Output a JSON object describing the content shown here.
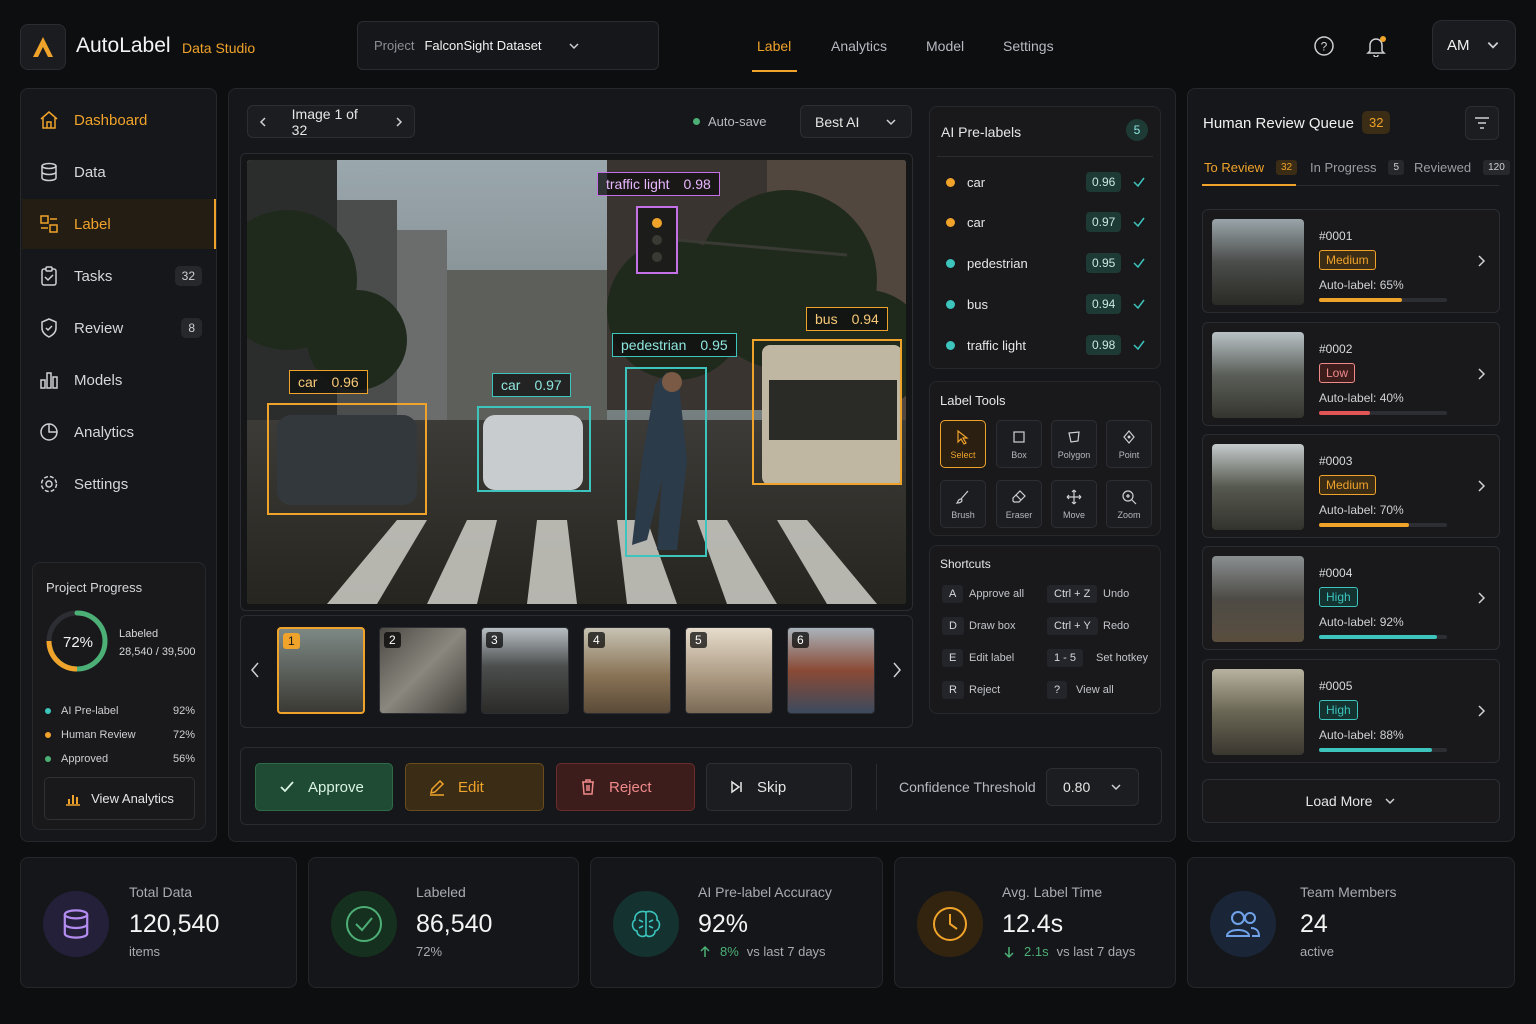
{
  "header": {
    "brand": "AutoLabel",
    "brand_sub": "Data Studio",
    "project_label": "Project",
    "project_value": "FalconSight Dataset",
    "nav": [
      "Label",
      "Analytics",
      "Model",
      "Settings"
    ],
    "active_nav": "Label",
    "avatar_initials": "AM"
  },
  "colors": {
    "accent": "#f0a32b",
    "teal": "#3cc4bd",
    "purple": "#c471e8",
    "green": "#4caf76",
    "red": "#e25555"
  },
  "sidebar": {
    "items": [
      {
        "label": "Dashboard",
        "icon": "home-icon",
        "badge": ""
      },
      {
        "label": "Data",
        "icon": "database-icon",
        "badge": ""
      },
      {
        "label": "Label",
        "icon": "label-icon",
        "badge": ""
      },
      {
        "label": "Tasks",
        "icon": "clipboard-icon",
        "badge": "32"
      },
      {
        "label": "Review",
        "icon": "shield-icon",
        "badge": "8"
      },
      {
        "label": "Models",
        "icon": "bar-chart-icon",
        "badge": ""
      },
      {
        "label": "Analytics",
        "icon": "pie-chart-icon",
        "badge": ""
      },
      {
        "label": "Settings",
        "icon": "gear-icon",
        "badge": ""
      }
    ],
    "progress": {
      "title": "Project Progress",
      "percent_label": "72%",
      "percent": 72,
      "labeled_label": "Labeled",
      "labeled_value": "28,540 / 39,500",
      "rows": [
        {
          "label": "AI Pre-label",
          "value": "92%",
          "color": "#3cc4bd"
        },
        {
          "label": "Human Review",
          "value": "72%",
          "color": "#f0a32b"
        },
        {
          "label": "Approved",
          "value": "56%",
          "color": "#4caf76"
        }
      ],
      "button": "View Analytics"
    }
  },
  "viewer": {
    "image_counter": "Image 1 of 32",
    "autosave": "Auto-save",
    "model_select": "Best AI",
    "boxes": [
      {
        "label": "traffic light",
        "score": "0.98"
      },
      {
        "label": "bus",
        "score": "0.94"
      },
      {
        "label": "pedestrian",
        "score": "0.95"
      },
      {
        "label": "car",
        "score": "0.96"
      },
      {
        "label": "car",
        "score": "0.97"
      }
    ],
    "thumbnails": [
      "1",
      "2",
      "3",
      "4",
      "5",
      "6"
    ]
  },
  "actions": {
    "approve": "Approve",
    "edit": "Edit",
    "reject": "Reject",
    "skip": "Skip",
    "threshold_label": "Confidence Threshold",
    "threshold_value": "0.80"
  },
  "prelabels": {
    "title": "AI Pre-labels",
    "count": "5",
    "items": [
      {
        "label": "car",
        "score": "0.96",
        "color": "#f0a32b"
      },
      {
        "label": "car",
        "score": "0.97",
        "color": "#f0a32b"
      },
      {
        "label": "pedestrian",
        "score": "0.95",
        "color": "#3cc4bd"
      },
      {
        "label": "bus",
        "score": "0.94",
        "color": "#3cc4bd"
      },
      {
        "label": "traffic light",
        "score": "0.98",
        "color": "#3cc4bd"
      }
    ]
  },
  "tools": {
    "title": "Label Tools",
    "items": [
      "Select",
      "Box",
      "Polygon",
      "Point",
      "Brush",
      "Eraser",
      "Move",
      "Zoom"
    ]
  },
  "shortcuts": {
    "title": "Shortcuts",
    "items": [
      {
        "key": "A",
        "desc": "Approve all"
      },
      {
        "key": "Ctrl + Z",
        "desc": "Undo"
      },
      {
        "key": "D",
        "desc": "Draw box"
      },
      {
        "key": "Ctrl + Y",
        "desc": "Redo"
      },
      {
        "key": "E",
        "desc": "Edit label"
      },
      {
        "key": "1 - 5",
        "desc": "Set hotkey"
      },
      {
        "key": "R",
        "desc": "Reject"
      },
      {
        "key": "?",
        "desc": "View all"
      }
    ]
  },
  "queue": {
    "title": "Human Review Queue",
    "count": "32",
    "tabs": [
      {
        "label": "To Review",
        "count": "32"
      },
      {
        "label": "In Progress",
        "count": "5"
      },
      {
        "label": "Reviewed",
        "count": "120"
      }
    ],
    "items": [
      {
        "id": "#0001",
        "priority": "Medium",
        "autolabel": "Auto-label:  65%",
        "pct": 0.65,
        "color": "#f0a32b"
      },
      {
        "id": "#0002",
        "priority": "Low",
        "autolabel": "Auto-label:  40%",
        "pct": 0.4,
        "color": "#e25555"
      },
      {
        "id": "#0003",
        "priority": "Medium",
        "autolabel": "Auto-label:  70%",
        "pct": 0.7,
        "color": "#f0a32b"
      },
      {
        "id": "#0004",
        "priority": "High",
        "autolabel": "Auto-label:  92%",
        "pct": 0.92,
        "color": "#3cc4bd"
      },
      {
        "id": "#0005",
        "priority": "High",
        "autolabel": "Auto-label:  88%",
        "pct": 0.88,
        "color": "#3cc4bd"
      }
    ],
    "load_more": "Load More"
  },
  "stats": [
    {
      "title": "Total Data",
      "value": "120,540",
      "sub": "items"
    },
    {
      "title": "Labeled",
      "value": "86,540",
      "sub": "72%"
    },
    {
      "title": "AI Pre-label Accuracy",
      "value": "92%",
      "delta": "8%",
      "sub": "vs last 7 days"
    },
    {
      "title": "Avg. Label Time",
      "value": "12.4s",
      "delta": "2.1s",
      "sub": "vs last 7 days"
    },
    {
      "title": "Team Members",
      "value": "24",
      "sub": "active"
    }
  ]
}
